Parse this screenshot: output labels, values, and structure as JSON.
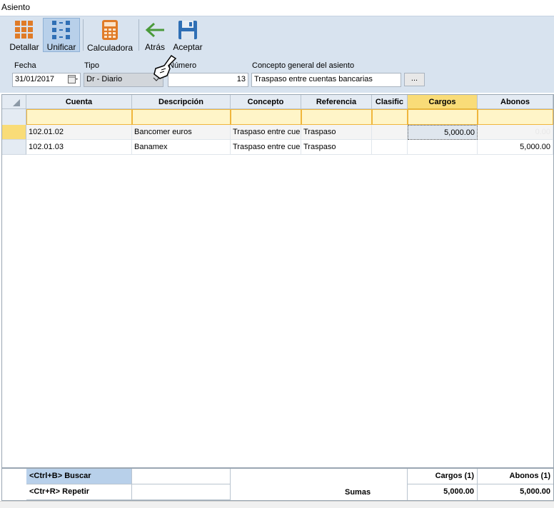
{
  "window": {
    "title": "Asiento"
  },
  "toolbar": {
    "detallar_label": "Detallar",
    "unificar_label": "Unificar",
    "calculadora_label": "Calculadora",
    "atras_label": "Atrás",
    "aceptar_label": "Aceptar"
  },
  "form": {
    "fecha_label": "Fecha",
    "fecha_value": "31/01/2017",
    "tipo_label": "Tipo",
    "tipo_value": "Dr - Diario",
    "numero_label": "Número",
    "numero_value": "13",
    "concepto_label": "Concepto general del asiento",
    "concepto_value": "Traspaso entre cuentas bancarias",
    "dots_label": "..."
  },
  "grid": {
    "headers": {
      "cuenta": "Cuenta",
      "descripcion": "Descripción",
      "concepto": "Concepto",
      "referencia": "Referencia",
      "clasific": "Clasific",
      "cargos": "Cargos",
      "abonos": "Abonos"
    },
    "rows": [
      {
        "cuenta": "102.01.02",
        "descripcion": "Bancomer euros",
        "concepto": "Traspaso entre cuentas bancarias",
        "referencia": "Traspaso",
        "clasific": "",
        "cargos": "5,000.00",
        "abonos": "0.00"
      },
      {
        "cuenta": "102.01.03",
        "descripcion": "Banamex",
        "concepto": "Traspaso entre cuentas bancarias",
        "referencia": "Traspaso",
        "clasific": "",
        "cargos": "",
        "abonos": "5,000.00"
      }
    ]
  },
  "footer": {
    "buscar": "<Ctrl+B> Buscar",
    "repetir": "<Ctr+R> Repetir",
    "sumas_label": "Sumas",
    "cargos_header": "Cargos (1)",
    "abonos_header": "Abonos (1)",
    "cargos_total": "5,000.00",
    "abonos_total": "5,000.00"
  },
  "colors": {
    "toolbar_bg": "#d8e3ef",
    "highlight_header": "#f9dc78",
    "filter_row": "#fff5c8",
    "selected_row_marker": "#f9dc78",
    "footer_highlight": "#b8d0ea"
  }
}
